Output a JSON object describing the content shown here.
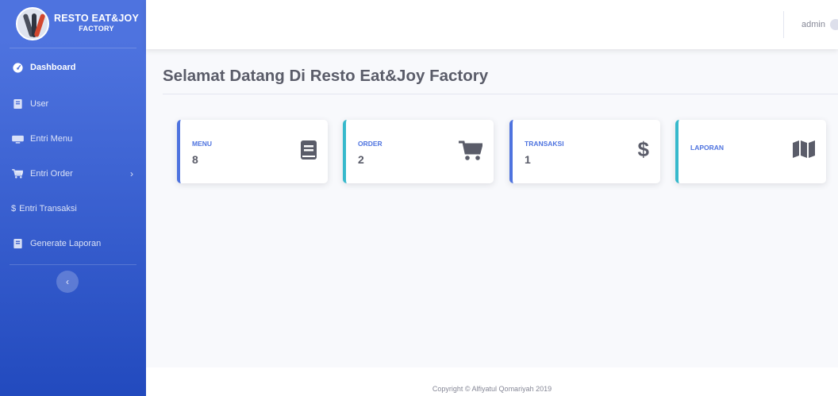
{
  "brand": {
    "line1": "RESTO EAT&JOY",
    "line2": "FACTORY"
  },
  "sidebar": {
    "items": [
      {
        "label": "Dashboard",
        "icon": "tachometer-icon"
      },
      {
        "label": "User",
        "icon": "book-icon"
      },
      {
        "label": "Entri Menu",
        "icon": "keyboard-icon"
      },
      {
        "label": "Entri Order",
        "icon": "cart-icon",
        "has_submenu": true
      },
      {
        "label": "Entri Transaksi",
        "icon": "dollar-icon"
      },
      {
        "label": "Generate Laporan",
        "icon": "book-icon"
      }
    ],
    "toggle_icon": "chevron-left-icon"
  },
  "topbar": {
    "user_name": "admin",
    "user_icon": "user-circle-icon"
  },
  "main": {
    "title": "Selamat Datang Di Resto Eat&Joy Factory",
    "cards": [
      {
        "label": "MENU",
        "value": "8",
        "icon": "book-icon",
        "accent": "#4e73df"
      },
      {
        "label": "ORDER",
        "value": "2",
        "icon": "cart-icon",
        "accent": "#36b9cc"
      },
      {
        "label": "TRANSAKSI",
        "value": "1",
        "icon": "dollar-icon",
        "accent": "#4e73df"
      },
      {
        "label": "LAPORAN",
        "value": "",
        "icon": "map-icon",
        "accent": "#36b9cc"
      }
    ]
  },
  "footer": {
    "copyright": "Copyright © Alfiyatul Qomariyah 2019"
  },
  "colors": {
    "primary": "#4e73df",
    "info": "#36b9cc",
    "text_gray": "#5a5c69",
    "muted": "#858796"
  }
}
